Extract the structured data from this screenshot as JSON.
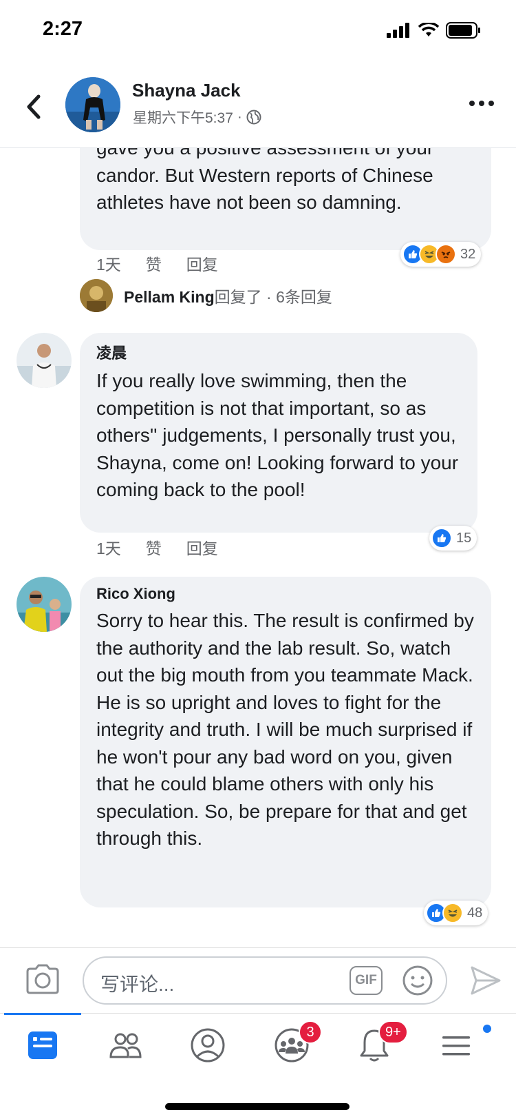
{
  "status_bar": {
    "time": "2:27"
  },
  "header": {
    "name": "Shayna Jack",
    "timestamp": "星期六下午5:37",
    "separator": "·",
    "icons": {
      "back": "chevron-left-icon",
      "privacy": "globe-icon",
      "more": "more-horizontal-icon"
    }
  },
  "comments": [
    {
      "text": "gave you a positive assessment of your candor. But Western reports of Chinese athletes have not been so damning.",
      "time": "1天",
      "like_label": "赞",
      "reply_label": "回复",
      "reaction_count": "32",
      "reply_summary": {
        "name": "Pellam King",
        "text": "回复了 · 6条回复"
      }
    },
    {
      "author": "凌晨",
      "text": "If you really love swimming, then the competition is not that important, so as others'' judgements, I personally trust you, Shayna, come on! Looking forward to your coming back to the pool!",
      "time": "1天",
      "like_label": "赞",
      "reply_label": "回复",
      "reaction_count": "15"
    },
    {
      "author": "Rico Xiong",
      "text": "Sorry to hear this. The result is confirmed by the authority and the lab result. So, watch out the big mouth from you teammate Mack. He is so upright and loves to fight for the integrity and truth. I will be much surprised if he won't pour any bad word on you, given that he could blame others with only his speculation.  So, be prepare for that and get through this.",
      "reaction_count": "48"
    }
  ],
  "composer": {
    "placeholder": "写评论...",
    "gif_label": "GIF"
  },
  "tabbar": {
    "groups_badge": "3",
    "notifications_badge": "9+"
  },
  "colors": {
    "accent": "#1877f2",
    "badge": "#e41e3f",
    "bubble": "#f0f2f5"
  }
}
